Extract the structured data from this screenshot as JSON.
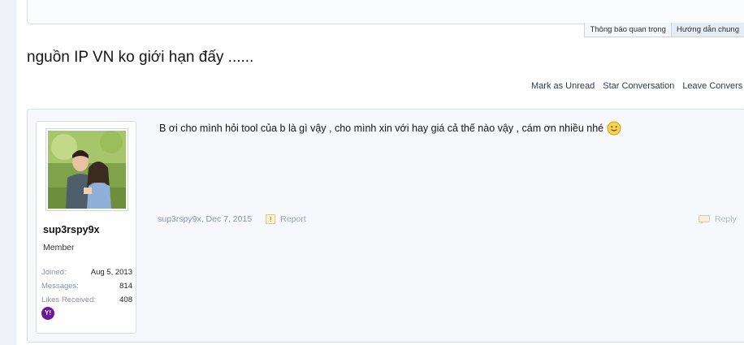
{
  "notices": {
    "tabs": [
      "Thông báo quan trọng",
      "Hướng dẫn chung"
    ]
  },
  "thread": {
    "title": "nguồn IP VN ko giới hạn đấy ......"
  },
  "thread_actions": {
    "mark_unread": "Mark as Unread",
    "star": "Star Conversation",
    "leave": "Leave Convers"
  },
  "message": {
    "text": "B ơi cho mình hỏi tool của b là gì vậy , cho mình xin với hay giá cả thế nào vậy , cám ơn nhiều nhé",
    "author": "sup3rspy9x",
    "date": "Dec 7, 2015",
    "report_label": "Report",
    "reply_label": "Reply"
  },
  "user": {
    "username": "sup3rspy9x",
    "title": "Member",
    "stats": [
      {
        "label": "Joined:",
        "value": "Aug 5, 2013"
      },
      {
        "label": "Messages:",
        "value": "814"
      },
      {
        "label": "Likes Received:",
        "value": "408"
      }
    ],
    "contact_icon": "yahoo-icon"
  },
  "colors": {
    "link": "#2b3a4e",
    "muted": "#8a95a3",
    "border": "#d7dde6",
    "panel_bg": "#f6f8fb"
  }
}
